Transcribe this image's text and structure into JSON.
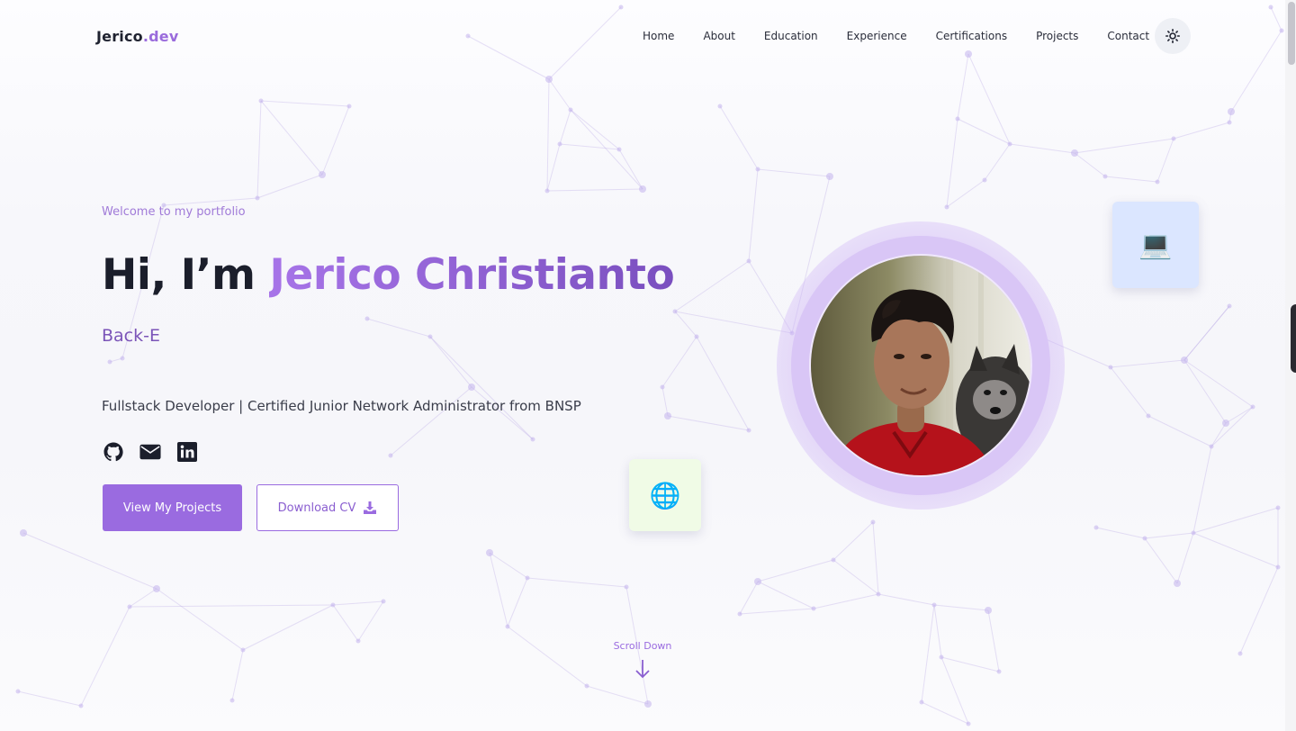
{
  "nav": {
    "logo_main": "Jerico",
    "logo_accent": ".dev",
    "links": [
      "Home",
      "About",
      "Education",
      "Experience",
      "Certifications",
      "Projects",
      "Contact"
    ],
    "theme_icon": "sun-icon"
  },
  "hero": {
    "welcome": "Welcome to my portfolio",
    "greeting": "Hi, I’m ",
    "name": "Jerico Christianto",
    "typed_text": "Back-E",
    "tagline": "Fullstack Developer | Certified Junior Network Administrator from BNSP",
    "socials": [
      "github-icon",
      "email-icon",
      "linkedin-icon"
    ],
    "primary_button": "View My Projects",
    "secondary_button": "Download CV"
  },
  "floating_cards": {
    "laptop_icon": "💻",
    "globe_icon": "🌐"
  },
  "scroll": {
    "label": "Scroll Down"
  },
  "colors": {
    "accent": "#9a6be0",
    "accent_dark": "#7b54b8",
    "text": "#1b1e2b",
    "laptop_card": "#dbe6ff",
    "globe_card": "#f0fbe6"
  }
}
